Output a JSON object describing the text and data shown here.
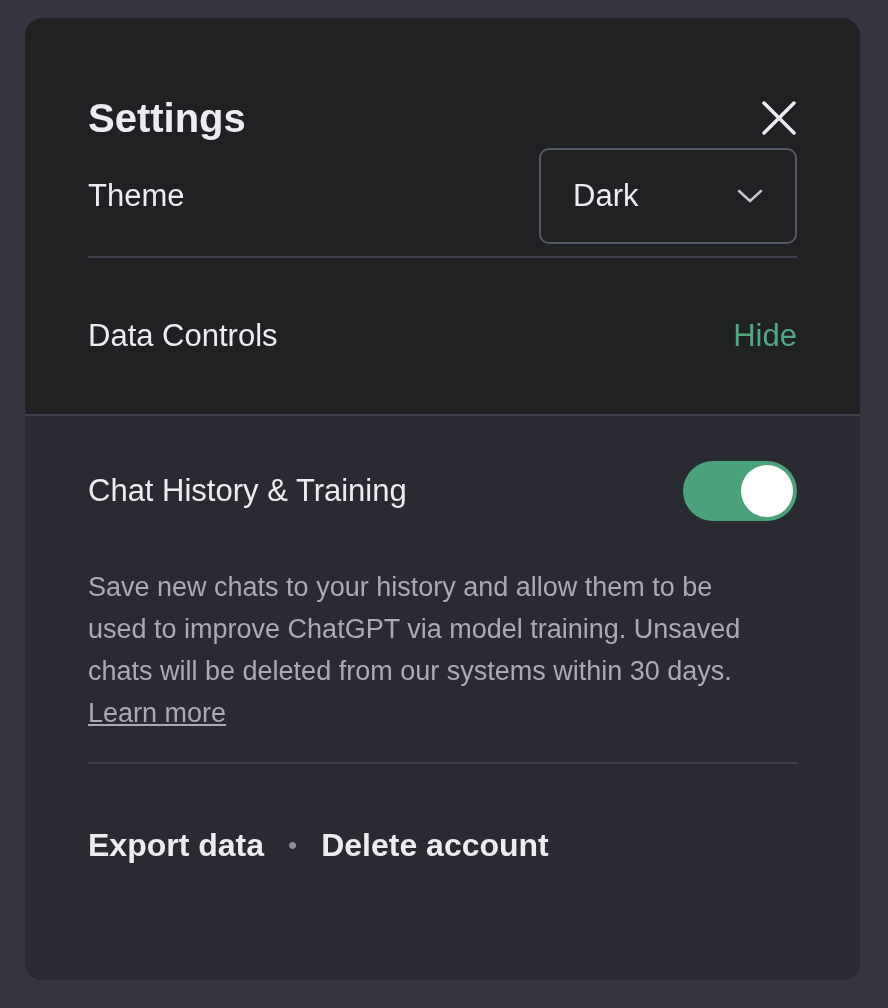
{
  "dialog": {
    "title": "Settings"
  },
  "theme": {
    "label": "Theme",
    "value": "Dark"
  },
  "data_controls": {
    "label": "Data Controls",
    "toggle_link": "Hide",
    "expanded": true
  },
  "chat_history": {
    "label": "Chat History & Training",
    "on": true,
    "description": "Save new chats to your history and allow them to be used to improve ChatGPT via model training. Unsaved chats will be deleted from our systems within 30 days.",
    "link": "Learn more"
  },
  "footer_links": [
    "Export data",
    "Delete account"
  ],
  "separator": "•"
}
